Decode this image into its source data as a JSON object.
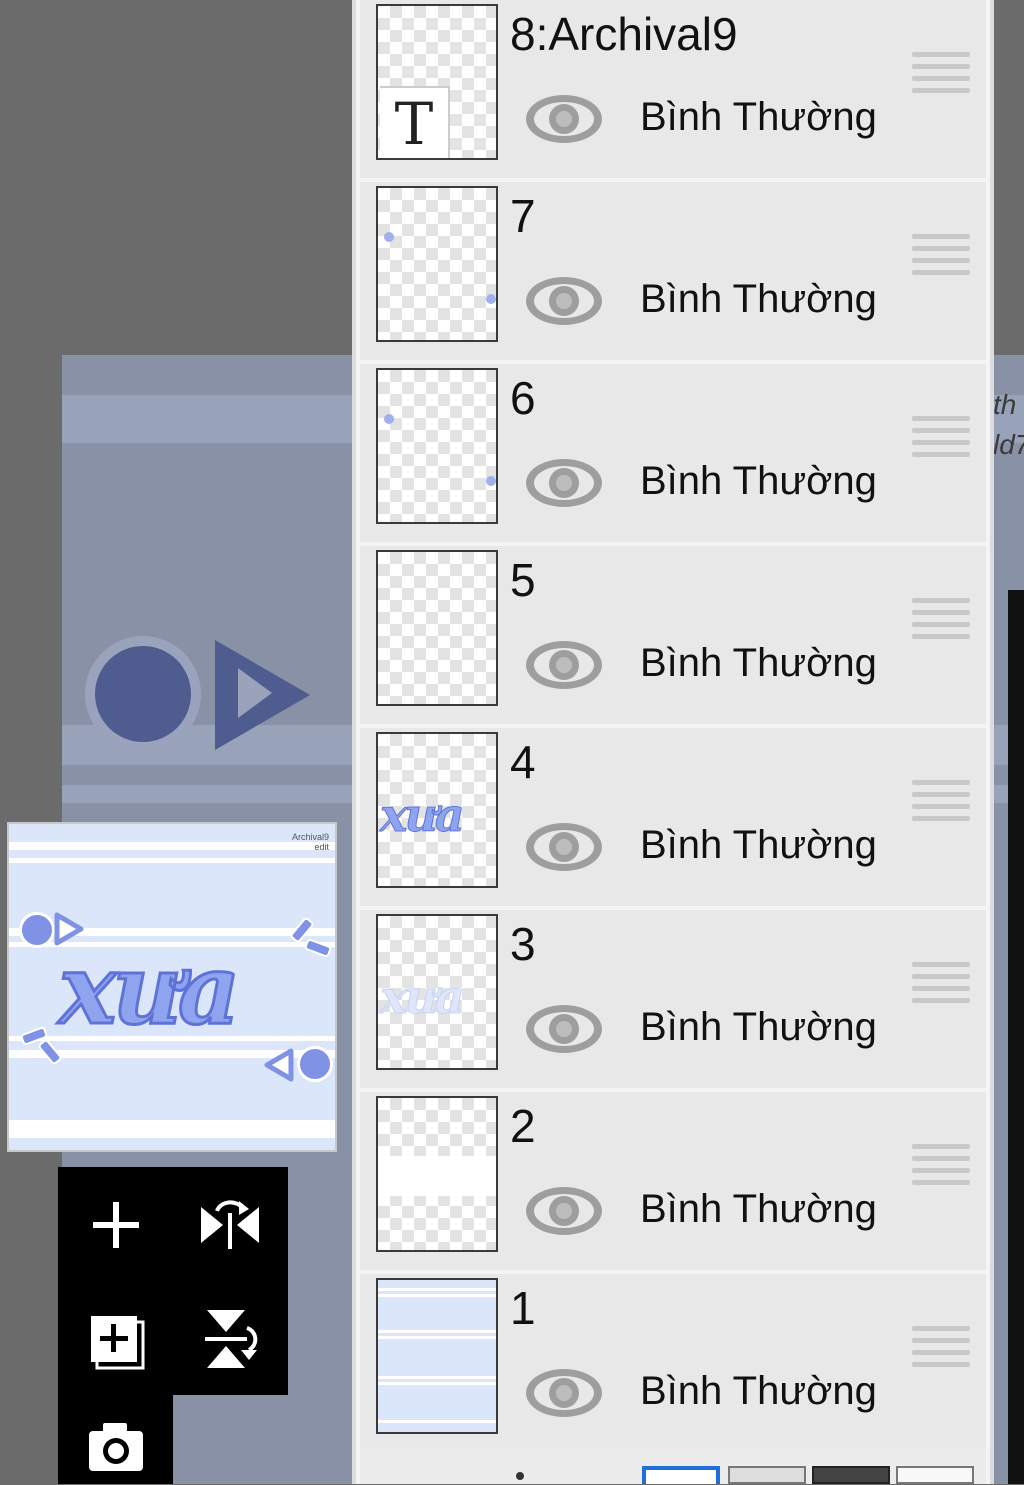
{
  "canvas_background": {
    "partial_text_lines": [
      "th",
      "ld7"
    ]
  },
  "preview": {
    "credit_lines": [
      "Archival9",
      "edit"
    ],
    "word": "xưa"
  },
  "tools": [
    {
      "name": "add-layer-icon",
      "label": "+"
    },
    {
      "name": "flip-horizontal-icon",
      "label": ""
    },
    {
      "name": "add-layer-copy-icon",
      "label": "+"
    },
    {
      "name": "flip-vertical-icon",
      "label": ""
    },
    {
      "name": "camera-icon",
      "label": ""
    }
  ],
  "layers": [
    {
      "name": "8:Archival9",
      "blend": "Bình Thường",
      "visible": true,
      "kind": "text",
      "thumb_glyph": "T"
    },
    {
      "name": "7",
      "blend": "Bình Thường",
      "visible": true,
      "kind": "shapes"
    },
    {
      "name": "6",
      "blend": "Bình Thường",
      "visible": true,
      "kind": "shapes"
    },
    {
      "name": "5",
      "blend": "Bình Thường",
      "visible": true,
      "kind": "empty"
    },
    {
      "name": "4",
      "blend": "Bình Thường",
      "visible": true,
      "kind": "word",
      "thumb_glyph": "xưa"
    },
    {
      "name": "3",
      "blend": "Bình Thường",
      "visible": true,
      "kind": "word-light",
      "thumb_glyph": "xưa"
    },
    {
      "name": "2",
      "blend": "Bình Thường",
      "visible": true,
      "kind": "white"
    },
    {
      "name": "1",
      "blend": "Bình Thường",
      "visible": true,
      "kind": "stripes"
    }
  ],
  "colors": {
    "accent_blue": "#7f92e6",
    "panel_bg": "#e8e8e8",
    "eye_gray": "#9e9e9e",
    "selected_mode_blue": "#1e6fd9"
  }
}
